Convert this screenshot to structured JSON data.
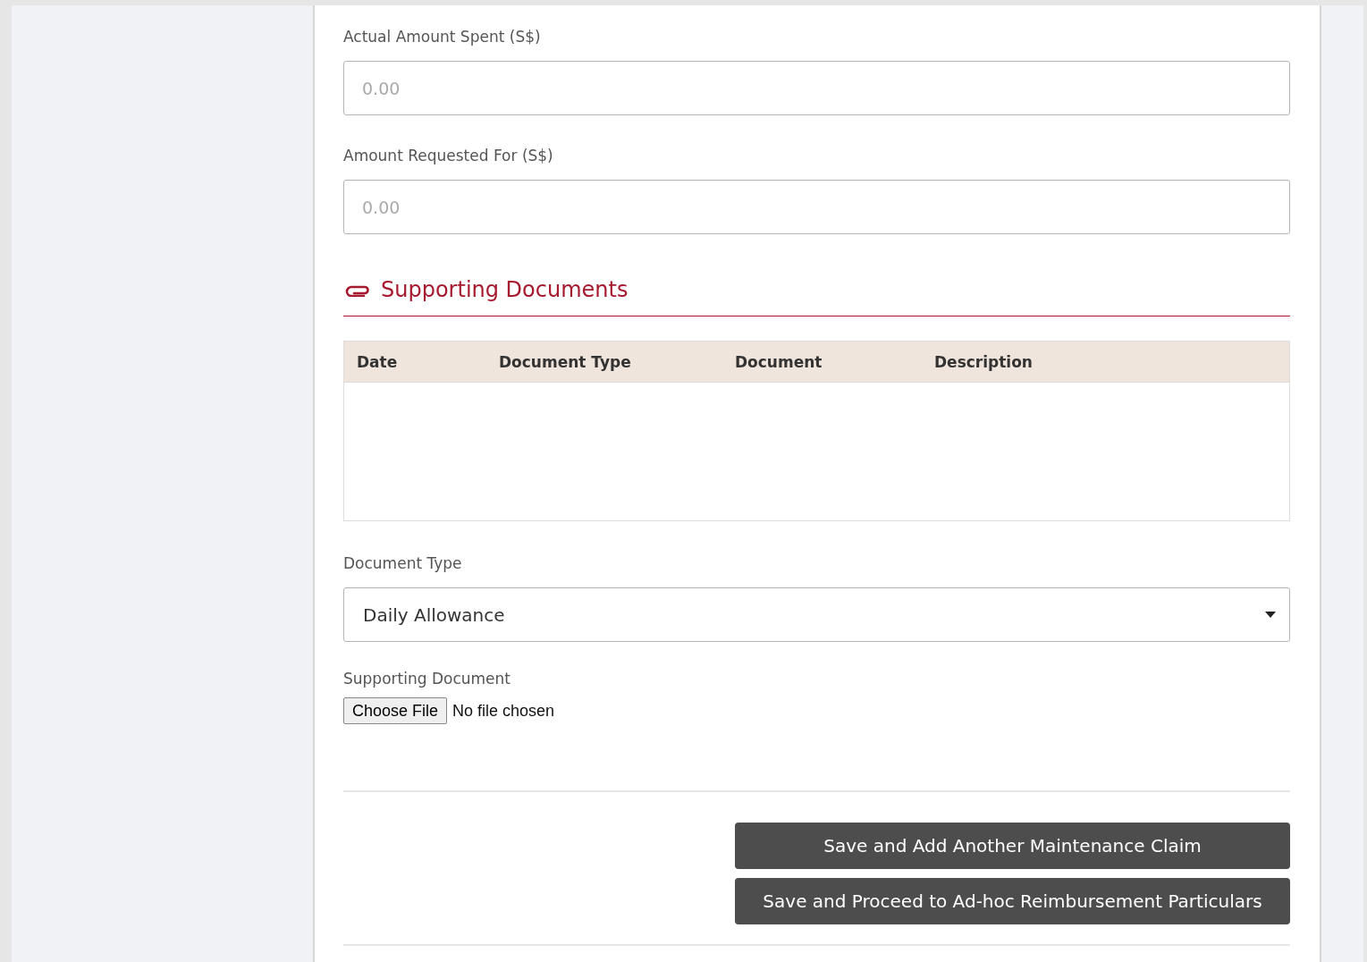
{
  "amount_fields": [
    {
      "label": "Actual Amount Spent (S$)",
      "placeholder": "0.00"
    },
    {
      "label": "Amount Requested For (S$)",
      "placeholder": "0.00"
    }
  ],
  "supporting_documents": {
    "title": "Supporting Documents",
    "table": {
      "columns": [
        "Date",
        "Document Type",
        "Document",
        "Description"
      ]
    },
    "document_type": {
      "label": "Document Type",
      "value": "Daily Allowance"
    },
    "supporting_document": {
      "label": "Supporting Document",
      "button": "Choose File",
      "status": "No file chosen"
    }
  },
  "buttons": [
    "Save and Add Another Maintenance Claim",
    "Save and Proceed to Ad-hoc Reimbursement Particulars"
  ]
}
